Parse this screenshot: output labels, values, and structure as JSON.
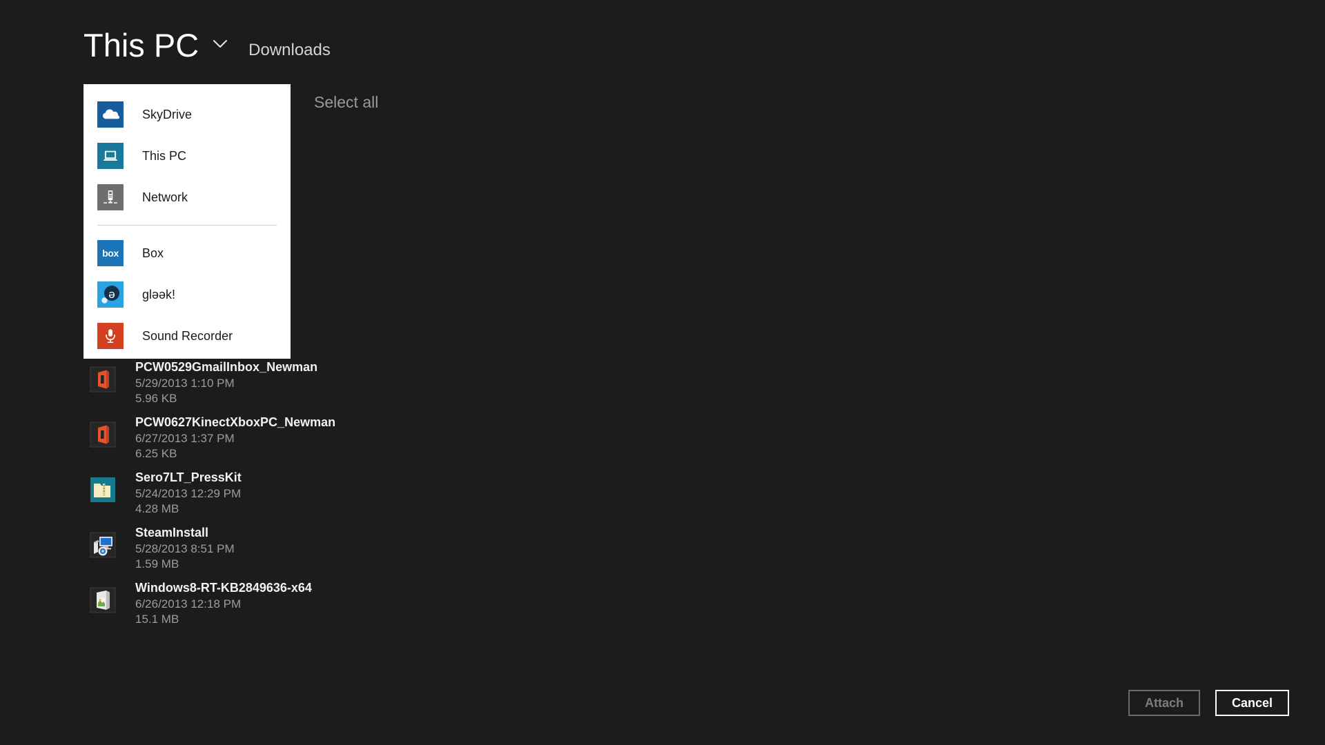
{
  "header": {
    "location_title": "This PC",
    "dropdown_icon": "chevron-down-icon",
    "current_folder": "Downloads"
  },
  "commandbar": {
    "select_all_label": "Select all"
  },
  "dropdown": {
    "groups": [
      {
        "items": [
          {
            "label": "SkyDrive",
            "icon": "skydrive-cloud-icon",
            "tile_color": "#175d9e"
          },
          {
            "label": "This PC",
            "icon": "laptop-icon",
            "tile_color": "#19799b"
          },
          {
            "label": "Network",
            "icon": "network-server-icon",
            "tile_color": "#6e6e6e"
          }
        ]
      },
      {
        "items": [
          {
            "label": "Box",
            "icon": "box-logo-icon",
            "tile_color": "#1b74b5",
            "tile_text": "box"
          },
          {
            "label": "gləək!",
            "icon": "gleek-schwa-icon",
            "tile_color": "#2ba3e3"
          },
          {
            "label": "Sound Recorder",
            "icon": "microphone-icon",
            "tile_color": "#d43f20"
          }
        ]
      }
    ]
  },
  "files": [
    {
      "name": "PCW0529GmailInbox_Newman",
      "date": "5/29/2013 1:10 PM",
      "size": "5.96 KB",
      "icon": "office-document-icon"
    },
    {
      "name": "PCW0627KinectXboxPC_Newman",
      "date": "6/27/2013 1:37 PM",
      "size": "6.25 KB",
      "icon": "office-document-icon"
    },
    {
      "name": "Sero7LT_PressKit",
      "date": "5/24/2013 12:29 PM",
      "size": "4.28 MB",
      "icon": "zipped-folder-icon"
    },
    {
      "name": "SteamInstall",
      "date": "5/28/2013 8:51 PM",
      "size": "1.59 MB",
      "icon": "installer-setup-icon"
    },
    {
      "name": "Windows8-RT-KB2849636-x64",
      "date": "6/26/2013 12:18 PM",
      "size": "15.1 MB",
      "icon": "windows-update-package-icon"
    }
  ],
  "footer": {
    "attach_label": "Attach",
    "attach_enabled": false,
    "cancel_label": "Cancel",
    "cancel_enabled": true
  },
  "colors": {
    "background": "#1c1c1c",
    "flyout_background": "#ffffff",
    "primary_text": "#ffffff",
    "secondary_text": "#9d9d9d",
    "disabled_text": "#7d7d7d"
  }
}
